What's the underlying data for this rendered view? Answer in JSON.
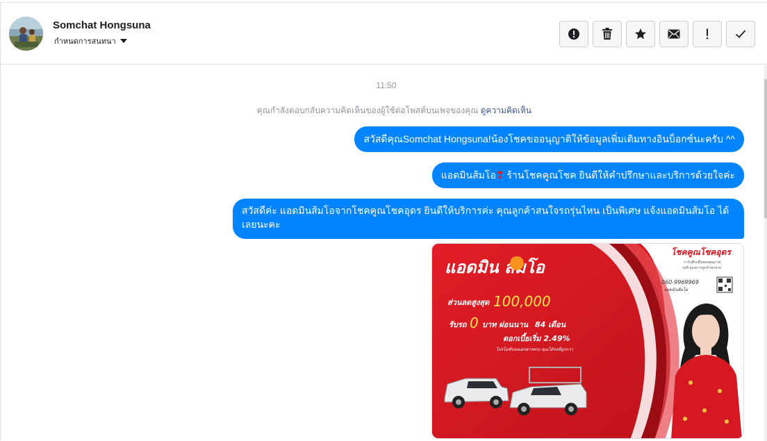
{
  "header": {
    "name": "Somchat Hongsuna",
    "subtitle": "กำหนดการสนทนา",
    "actions": [
      {
        "icon": "alert-circle-icon",
        "label": "Mark as spam"
      },
      {
        "icon": "trash-icon",
        "label": "Delete"
      },
      {
        "icon": "star-icon",
        "label": "Star"
      },
      {
        "icon": "envelope-icon",
        "label": "Mark as unread"
      },
      {
        "icon": "exclamation-icon",
        "label": "Follow up"
      },
      {
        "icon": "checkmark-icon",
        "label": "Done"
      }
    ]
  },
  "chat": {
    "time": "11:50",
    "reply_note": "คุณกำลังตอบกลับความคิดเห็นของผู้ใช้ต่อโพสต์บนเพจของคุณ",
    "reply_link": "ดูความคิดเห็น",
    "messages": [
      {
        "text": "สวัสดีคุณSomchat Hongsuna!น้องโชคขออนุญาติให้ข้อมูลเพิ่มเติมทางอินบ็อกซ์นะครับ ^^"
      },
      {
        "text_a": "แอดมินส้มโอ",
        "emoji": "❣",
        "text_b": " ร้านโชคคูณโชค ยินดีให้คำปรึกษาและบริการด้วยใจค่ะ"
      },
      {
        "text": "สวัสดีค่ะ แอดมินส้มโอจากโชคคูณโชคอุดร ยินดีให้บริการค่ะ   คุณลูกค้าสนใจรถรุ่นไหน เป็นพิเศษ แจ้งแอดมินส้มโอ ได้เลยนะคะ"
      }
    ],
    "ad": {
      "headline": "แอดมิน ส้มโอ",
      "shop": "โชคคูณโชคอุดร",
      "shop_sub1": "การันตีรถมือสองคุณภาพ",
      "shop_sub2": "รถดี ดูแลการลูกค้าทุกสาย",
      "phone": "060-9969969",
      "admin_tag": "แอดมินส้มโอ",
      "discount_label": "ส่วนลดสูงสุด",
      "discount_value": "100,000",
      "line2_a": "รับรถ",
      "line2_zero": "0",
      "line2_b": "บาท ผ่อนนาน",
      "line2_c": "84 เดือน",
      "line3": "ดอกเบี้ยเริ่ม 2.49%",
      "fine_print": "โปรโมชั่นขอเอกสารครบ คุณได้รถที่ถูกกว่า",
      "colors": {
        "red": "#d51822",
        "yellow": "#ffe34d"
      }
    }
  }
}
